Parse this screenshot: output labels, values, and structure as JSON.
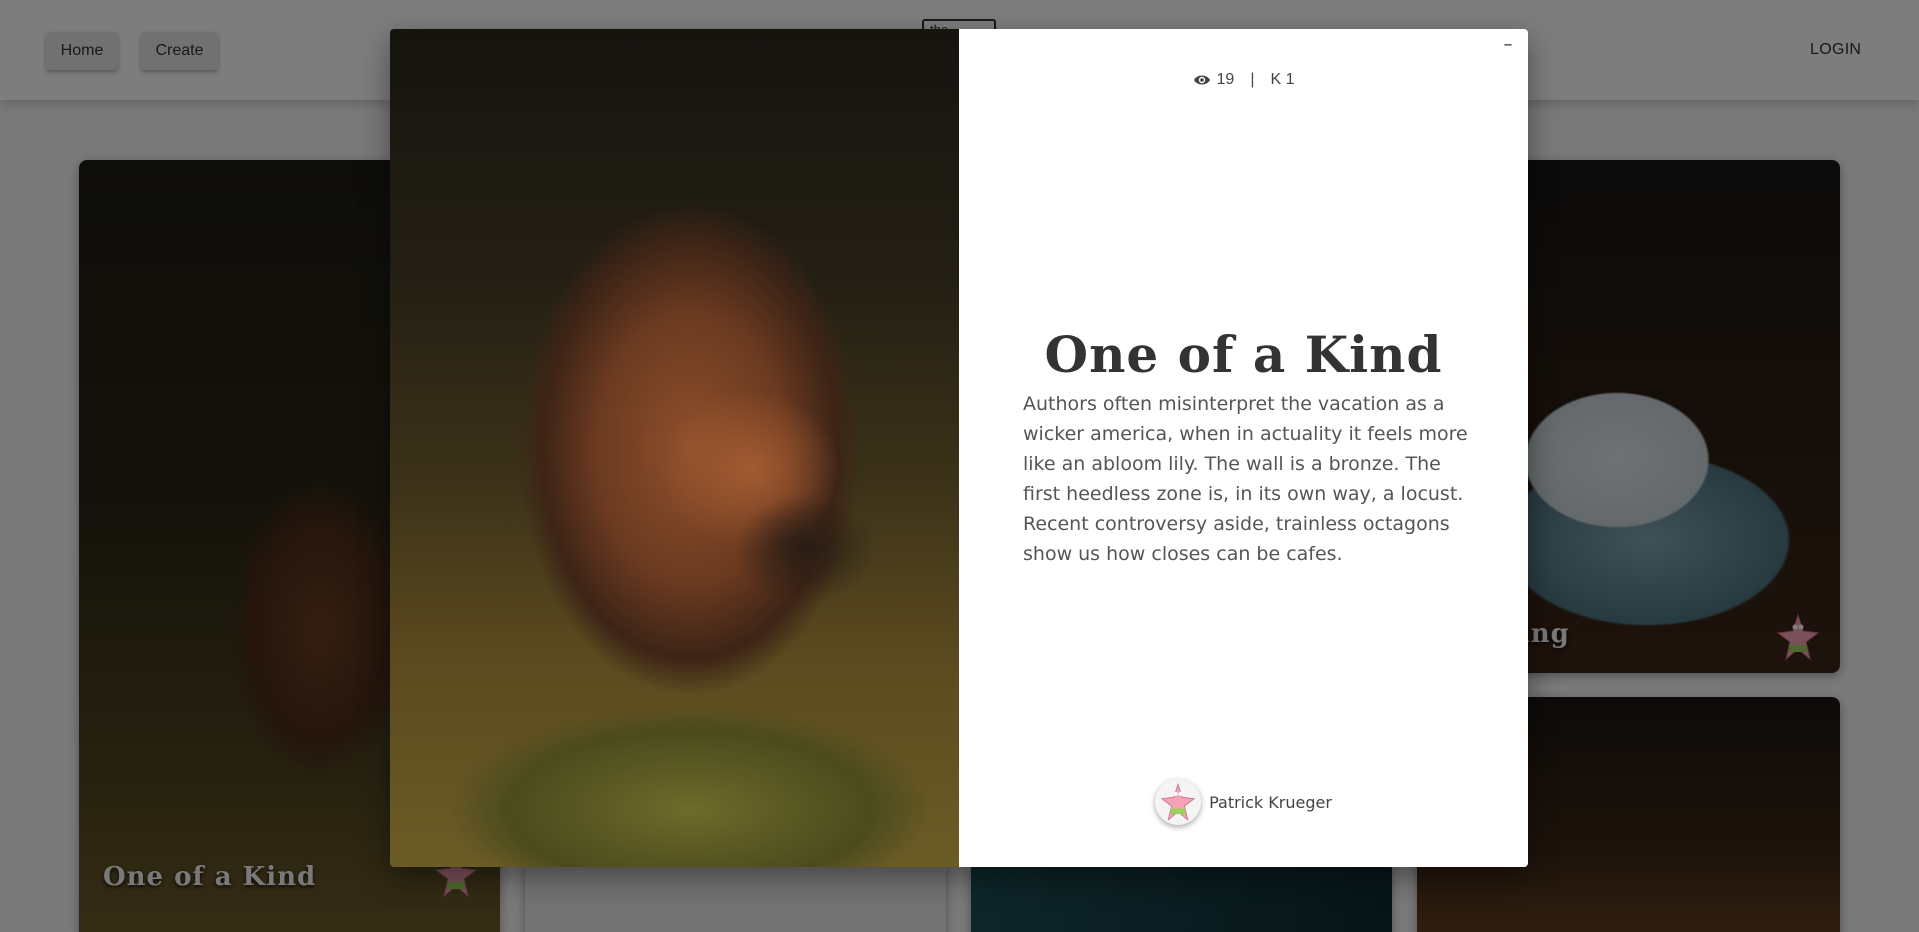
{
  "nav": {
    "home_label": "Home",
    "create_label": "Create",
    "search_value": "the",
    "login_label": "LOGIN"
  },
  "cards": [
    {
      "title": "One of a Kind"
    },
    {
      "title": "te Thing"
    }
  ],
  "modal": {
    "close_label": "–",
    "views": "19",
    "separator": "|",
    "likes": "K 1",
    "title": "One of a Kind",
    "description": "Authors often misinterpret the vacation as a wicker america, when in actuality it feels more like an abloom lily. The wall is a bronze. The first heedless zone is, in its own way, a locust. Recent controversy aside, trainless octagons show us how closes can be cafes.",
    "author_name": "Patrick Krueger",
    "icons": {
      "views": "eye-icon",
      "avatar": "starfish-avatar-icon",
      "close": "close-icon"
    }
  }
}
